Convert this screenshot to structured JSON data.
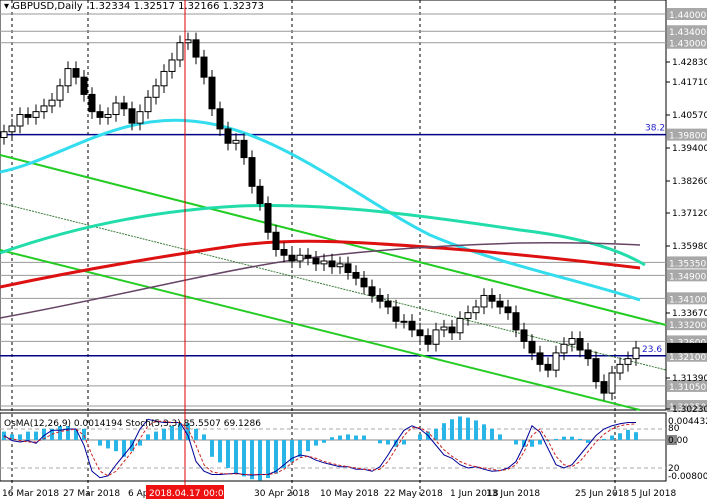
{
  "header": {
    "symbol": "GBPUSD,Daily",
    "ohlc": "1.32334 1.32517 1.32166 1.32373"
  },
  "chart_data": [
    {
      "type": "candlestick",
      "title": "GBPUSD,Daily",
      "ylim": [
        1.3035,
        1.44
      ],
      "price_ticks": [
        "1.42830",
        "1.41710",
        "1.40570",
        "1.39400",
        "1.38260",
        "1.37120",
        "1.35980",
        "1.33670",
        "1.31390",
        "1.30230"
      ],
      "levels": [
        {
          "label": "1.44000",
          "v": 1.44
        },
        {
          "label": "1.43400",
          "v": 1.434
        },
        {
          "label": "1.43000",
          "v": 1.43
        },
        {
          "label": "1.39800",
          "v": 1.398
        },
        {
          "label": "1.35350",
          "v": 1.3535
        },
        {
          "label": "1.34900",
          "v": 1.349
        },
        {
          "label": "1.34100",
          "v": 1.341
        },
        {
          "label": "1.33200",
          "v": 1.332
        },
        {
          "label": "1.32600",
          "v": 1.326
        },
        {
          "label": "1.32100",
          "v": 1.321
        },
        {
          "label": "1.31050",
          "v": 1.3105
        },
        {
          "label": "1.30350",
          "v": 1.3035
        }
      ],
      "fib": [
        {
          "label": "38.2",
          "v": 1.398
        },
        {
          "label": "23.6",
          "v": 1.321
        }
      ],
      "current_price": 1.32373,
      "closes": [
        1.399,
        1.401,
        1.405,
        1.404,
        1.406,
        1.408,
        1.41,
        1.415,
        1.421,
        1.418,
        1.412,
        1.406,
        1.404,
        1.405,
        1.409,
        1.407,
        1.402,
        1.406,
        1.411,
        1.415,
        1.42,
        1.424,
        1.43,
        1.431,
        1.425,
        1.418,
        1.407,
        1.4,
        1.395,
        1.396,
        1.39,
        1.38,
        1.374,
        1.364,
        1.358,
        1.356,
        1.354,
        1.356,
        1.355,
        1.353,
        1.354,
        1.352,
        1.353,
        1.35,
        1.348,
        1.345,
        1.342,
        1.34,
        1.338,
        1.333,
        1.333,
        1.33,
        1.328,
        1.325,
        1.33,
        1.331,
        1.329,
        1.334,
        1.336,
        1.338,
        1.342,
        1.34,
        1.338,
        1.336,
        1.33,
        1.326,
        1.322,
        1.318,
        1.316,
        1.322,
        1.325,
        1.327,
        1.323,
        1.32,
        1.312,
        1.308,
        1.315,
        1.318,
        1.32,
        1.3237
      ],
      "x_labels": [
        "16 Mar 2018",
        "27 Mar 2018",
        "6 Apr 2018",
        "2018.04.17 00:00",
        "30 Apr 2018",
        "10 May 2018",
        "22 May 2018",
        "1 Jun 2018",
        "13 Jun 2018",
        "25 Jun 2018",
        "5 Jul 2018"
      ]
    },
    {
      "type": "indicator",
      "title": "OsMA(12,26,9) 0.0014194  Stoch(5,3,3) 85.5507 69.1286",
      "osma_ticks": [
        "0.004432",
        "0.00",
        "-0.008003"
      ],
      "stoch_ticks": [
        "80",
        "20"
      ],
      "osma": [
        0.0015,
        0.001,
        0.001,
        0.0015,
        0.0015,
        0.002,
        0.002,
        0.0025,
        0.0025,
        0.002,
        0.002,
        0,
        -0.001,
        -0.0015,
        -0.002,
        -0.003,
        -0.002,
        -0.001,
        0.001,
        0.0015,
        0.002,
        0.0025,
        0.003,
        0.003,
        0.002,
        0.001,
        -0.003,
        -0.004,
        -0.005,
        -0.006,
        -0.0065,
        -0.007,
        -0.0072,
        -0.0068,
        -0.006,
        -0.005,
        -0.004,
        -0.003,
        -0.002,
        -0.001,
        -0.0005,
        0.0005,
        0.0008,
        0.001,
        0.0008,
        0.0008,
        0,
        -0.0006,
        -0.0008,
        -0.0012,
        -0.0008,
        0,
        0.001,
        0.0015,
        0.002,
        0.003,
        0.0037,
        0.0042,
        0.004,
        0.0035,
        0.0028,
        0.002,
        0.001,
        0,
        -0.0008,
        -0.0012,
        -0.0012,
        -0.0008,
        -0.0002,
        0.0002,
        0.0006,
        0.0006,
        0.0002,
        -0.0005,
        0,
        0.0002,
        0.0008,
        0.0012,
        0.0018,
        0.0014
      ],
      "stoch_main": [
        70,
        62,
        60,
        62,
        58,
        70,
        78,
        78,
        80,
        80,
        55,
        15,
        5,
        8,
        25,
        40,
        55,
        80,
        95,
        92,
        90,
        90,
        90,
        70,
        30,
        15,
        10,
        10,
        11,
        12,
        10,
        9,
        10,
        10,
        15,
        25,
        35,
        40,
        38,
        32,
        28,
        25,
        22,
        22,
        18,
        18,
        15,
        22,
        40,
        60,
        78,
        85,
        80,
        70,
        55,
        40,
        35,
        25,
        20,
        22,
        18,
        15,
        16,
        20,
        30,
        55,
        85,
        75,
        50,
        25,
        20,
        25,
        40,
        55,
        70,
        80,
        85,
        88,
        90,
        90
      ],
      "stoch_signal": [
        68,
        65,
        62,
        60,
        60,
        65,
        72,
        76,
        78,
        80,
        70,
        40,
        15,
        8,
        15,
        30,
        45,
        65,
        85,
        92,
        92,
        90,
        90,
        80,
        55,
        25,
        14,
        12,
        11,
        11,
        10,
        10,
        10,
        10,
        12,
        18,
        28,
        36,
        38,
        35,
        30,
        27,
        24,
        22,
        20,
        18,
        17,
        18,
        30,
        50,
        70,
        82,
        82,
        75,
        62,
        48,
        38,
        30,
        25,
        22,
        20,
        18,
        16,
        18,
        25,
        45,
        70,
        80,
        62,
        38,
        25,
        22,
        30,
        45,
        60,
        72,
        80,
        85,
        87,
        88
      ]
    }
  ]
}
